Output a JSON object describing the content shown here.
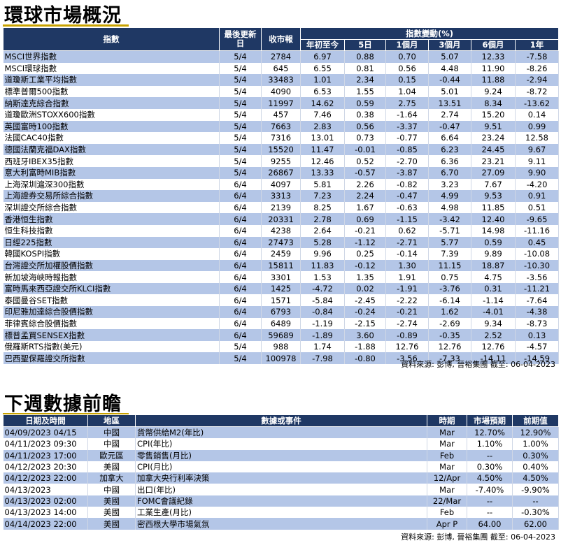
{
  "market": {
    "title": "環球市場概況",
    "headers": {
      "index": "指數",
      "last_update": "最後更新日",
      "close": "收市報",
      "change_group": "指數變動(%)",
      "ytd": "年初至今",
      "d5": "5日",
      "m1": "1個月",
      "m3": "3個月",
      "m6": "6個月",
      "y1": "1年"
    },
    "rows": [
      [
        "MSCI世界指數",
        "5/4",
        "2784",
        "6.97",
        "0.88",
        "0.70",
        "5.07",
        "12.33",
        "-7.58"
      ],
      [
        "MSCI環球指數",
        "5/4",
        "645",
        "6.55",
        "0.81",
        "0.56",
        "4.48",
        "11.90",
        "-8.26"
      ],
      [
        "道瓊斯工業平均指數",
        "5/4",
        "33483",
        "1.01",
        "2.34",
        "0.15",
        "-0.44",
        "11.88",
        "-2.94"
      ],
      [
        "標準普爾500指數",
        "5/4",
        "4090",
        "6.53",
        "1.55",
        "1.04",
        "5.01",
        "9.24",
        "-8.72"
      ],
      [
        "納斯達克綜合指數",
        "5/4",
        "11997",
        "14.62",
        "0.59",
        "2.75",
        "13.51",
        "8.34",
        "-13.62"
      ],
      [
        "道瓊歐洲STOXX600指數",
        "5/4",
        "457",
        "7.46",
        "0.38",
        "-1.64",
        "2.74",
        "15.20",
        "0.14"
      ],
      [
        "英國富時100指數",
        "5/4",
        "7663",
        "2.83",
        "0.56",
        "-3.37",
        "-0.47",
        "9.51",
        "0.99"
      ],
      [
        "法國CAC40指數",
        "5/4",
        "7316",
        "13.01",
        "0.73",
        "-0.77",
        "6.64",
        "23.24",
        "12.58"
      ],
      [
        "德國法蘭克福DAX指數",
        "5/4",
        "15520",
        "11.47",
        "-0.01",
        "-0.85",
        "6.23",
        "24.45",
        "9.67"
      ],
      [
        "西班牙IBEX35指數",
        "5/4",
        "9255",
        "12.46",
        "0.52",
        "-2.70",
        "6.36",
        "23.21",
        "9.11"
      ],
      [
        "意大利富時MIB指數",
        "5/4",
        "26867",
        "13.33",
        "-0.57",
        "-3.87",
        "6.70",
        "27.09",
        "9.90"
      ],
      [
        "上海深圳滬深300指數",
        "6/4",
        "4097",
        "5.81",
        "2.26",
        "-0.82",
        "3.23",
        "7.67",
        "-4.20"
      ],
      [
        "上海證券交易所綜合指數",
        "6/4",
        "3313",
        "7.23",
        "2.24",
        "-0.47",
        "4.99",
        "9.53",
        "0.91"
      ],
      [
        "深圳證交所綜合指數",
        "6/4",
        "2139",
        "8.25",
        "1.67",
        "-0.63",
        "4.98",
        "11.85",
        "0.51"
      ],
      [
        "香港恒生指數",
        "6/4",
        "20331",
        "2.78",
        "0.69",
        "-1.15",
        "-3.42",
        "12.40",
        "-9.65"
      ],
      [
        "恒生科技指數",
        "6/4",
        "4238",
        "2.64",
        "-0.21",
        "0.62",
        "-5.71",
        "14.98",
        "-11.16"
      ],
      [
        "日經225指數",
        "6/4",
        "27473",
        "5.28",
        "-1.12",
        "-2.71",
        "5.77",
        "0.59",
        "0.45"
      ],
      [
        "韓國KOSPI指數",
        "6/4",
        "2459",
        "9.96",
        "0.25",
        "-0.14",
        "7.39",
        "9.89",
        "-10.08"
      ],
      [
        "台灣證交所加權股價指數",
        "6/4",
        "15811",
        "11.83",
        "-0.12",
        "1.30",
        "11.15",
        "18.87",
        "-10.30"
      ],
      [
        "新加坡海峽時報指數",
        "6/4",
        "3301",
        "1.53",
        "1.35",
        "1.91",
        "0.75",
        "4.75",
        "-3.56"
      ],
      [
        "富時馬來西亞證交所KLCI指數",
        "6/4",
        "1425",
        "-4.72",
        "0.02",
        "-1.91",
        "-3.76",
        "0.31",
        "-11.21"
      ],
      [
        "泰國曼谷SET指數",
        "6/4",
        "1571",
        "-5.84",
        "-2.45",
        "-2.22",
        "-6.14",
        "-1.14",
        "-7.64"
      ],
      [
        "印尼雅加達綜合股價指數",
        "6/4",
        "6793",
        "-0.84",
        "-0.24",
        "-0.21",
        "1.62",
        "-4.01",
        "-4.38"
      ],
      [
        "菲律賓綜合股價指數",
        "6/4",
        "6489",
        "-1.19",
        "-2.15",
        "-2.74",
        "-2.69",
        "9.34",
        "-8.73"
      ],
      [
        "標普孟買SENSEX指數",
        "6/4",
        "59689",
        "-1.89",
        "3.60",
        "-0.89",
        "-0.35",
        "2.52",
        "0.13"
      ],
      [
        "俄羅斯RTS指數(美元)",
        "5/4",
        "988",
        "1.74",
        "-1.88",
        "12.76",
        "12.76",
        "12.76",
        "-4.57"
      ],
      [
        "巴西聖保羅證交所指數",
        "5/4",
        "100978",
        "-7.98",
        "-0.80",
        "-3.56",
        "-7.33",
        "-14.11",
        "-14.59"
      ]
    ],
    "source": "資料來源: 彭博, 晉裕集團 截至: 06-04-2023"
  },
  "calendar": {
    "title": "下週數據前瞻",
    "headers": {
      "datetime": "日期及時間",
      "region": "地區",
      "event": "數據或事件",
      "period": "時期",
      "forecast": "市場預期",
      "previous": "前期值"
    },
    "rows": [
      [
        "04/09/2023 04/15",
        "中國",
        "貨幣供給M2(年比)",
        "Mar",
        "12.70%",
        "12.90%"
      ],
      [
        "04/11/2023 09:30",
        "中國",
        "CPI(年比)",
        "Mar",
        "1.10%",
        "1.00%"
      ],
      [
        "04/11/2023 17:00",
        "歐元區",
        "零售銷售(月比)",
        "Feb",
        "--",
        "0.30%"
      ],
      [
        "04/12/2023 20:30",
        "美國",
        "CPI(月比)",
        "Mar",
        "0.30%",
        "0.40%"
      ],
      [
        "04/12/2023 22:00",
        "加拿大",
        "加拿大央行利率決策",
        "12/Apr",
        "4.50%",
        "4.50%"
      ],
      [
        "04/13/2023",
        "中國",
        "出口(年比)",
        "Mar",
        "-7.40%",
        "-9.90%"
      ],
      [
        "04/13/2023 02:00",
        "美國",
        "FOMC會議紀錄",
        "22/Mar",
        "--",
        "--"
      ],
      [
        "04/13/2023 14:00",
        "美國",
        "工業生產(月比)",
        "Feb",
        "--",
        "-0.30%"
      ],
      [
        "04/14/2023 22:00",
        "美國",
        "密西根大學市場氣氛",
        "Apr P",
        "64.00",
        "62.00"
      ]
    ],
    "source": "資料來源: 彭博, 晉裕集團 截至: 06-04-2023"
  }
}
